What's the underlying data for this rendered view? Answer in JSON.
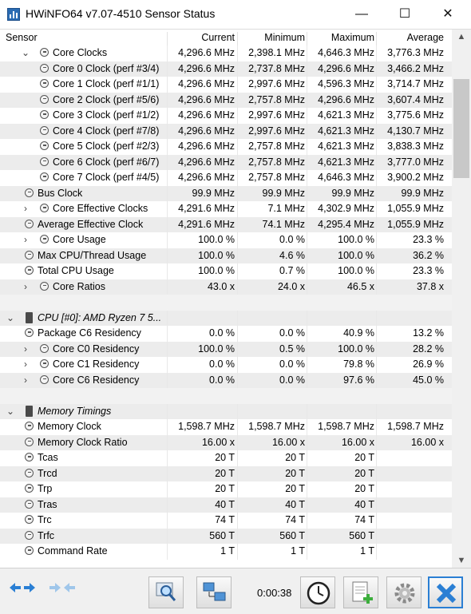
{
  "window": {
    "title": "HWiNFO64 v7.07-4510 Sensor Status",
    "minimize": "—",
    "maximize": "☐",
    "close": "✕"
  },
  "headers": {
    "sensor": "Sensor",
    "current": "Current",
    "minimum": "Minimum",
    "maximum": "Maximum",
    "average": "Average"
  },
  "rows": [
    {
      "indent": 1,
      "chev": "v",
      "icon": "clock",
      "name": "Core Clocks",
      "cur": "4,296.6 MHz",
      "min": "2,398.1 MHz",
      "max": "4,646.3 MHz",
      "avg": "3,776.3 MHz"
    },
    {
      "indent": 2,
      "icon": "clock",
      "name": "Core 0 Clock (perf #3/4)",
      "cur": "4,296.6 MHz",
      "min": "2,737.8 MHz",
      "max": "4,296.6 MHz",
      "avg": "3,466.2 MHz"
    },
    {
      "indent": 2,
      "icon": "clock",
      "name": "Core 1 Clock (perf #1/1)",
      "cur": "4,296.6 MHz",
      "min": "2,997.6 MHz",
      "max": "4,596.3 MHz",
      "avg": "3,714.7 MHz"
    },
    {
      "indent": 2,
      "icon": "clock",
      "name": "Core 2 Clock (perf #5/6)",
      "cur": "4,296.6 MHz",
      "min": "2,757.8 MHz",
      "max": "4,296.6 MHz",
      "avg": "3,607.4 MHz"
    },
    {
      "indent": 2,
      "icon": "clock",
      "name": "Core 3 Clock (perf #1/2)",
      "cur": "4,296.6 MHz",
      "min": "2,997.6 MHz",
      "max": "4,621.3 MHz",
      "avg": "3,775.6 MHz"
    },
    {
      "indent": 2,
      "icon": "clock",
      "name": "Core 4 Clock (perf #7/8)",
      "cur": "4,296.6 MHz",
      "min": "2,997.6 MHz",
      "max": "4,621.3 MHz",
      "avg": "4,130.7 MHz"
    },
    {
      "indent": 2,
      "icon": "clock",
      "name": "Core 5 Clock (perf #2/3)",
      "cur": "4,296.6 MHz",
      "min": "2,757.8 MHz",
      "max": "4,621.3 MHz",
      "avg": "3,838.3 MHz"
    },
    {
      "indent": 2,
      "icon": "clock",
      "name": "Core 6 Clock (perf #6/7)",
      "cur": "4,296.6 MHz",
      "min": "2,757.8 MHz",
      "max": "4,621.3 MHz",
      "avg": "3,777.0 MHz"
    },
    {
      "indent": 2,
      "icon": "clock",
      "name": "Core 7 Clock (perf #4/5)",
      "cur": "4,296.6 MHz",
      "min": "2,757.8 MHz",
      "max": "4,646.3 MHz",
      "avg": "3,900.2 MHz"
    },
    {
      "indent": 0,
      "icon": "clock",
      "name": "Bus Clock",
      "cur": "99.9 MHz",
      "min": "99.9 MHz",
      "max": "99.9 MHz",
      "avg": "99.9 MHz"
    },
    {
      "indent": 1,
      "chev": ">",
      "icon": "clock",
      "name": "Core Effective Clocks",
      "cur": "4,291.6 MHz",
      "min": "7.1 MHz",
      "max": "4,302.9 MHz",
      "avg": "1,055.9 MHz"
    },
    {
      "indent": 0,
      "icon": "clock",
      "name": "Average Effective Clock",
      "cur": "4,291.6 MHz",
      "min": "74.1 MHz",
      "max": "4,295.4 MHz",
      "avg": "1,055.9 MHz"
    },
    {
      "indent": 1,
      "chev": ">",
      "icon": "clock",
      "name": "Core Usage",
      "cur": "100.0 %",
      "min": "0.0 %",
      "max": "100.0 %",
      "avg": "23.3 %"
    },
    {
      "indent": 0,
      "icon": "clock",
      "name": "Max CPU/Thread Usage",
      "cur": "100.0 %",
      "min": "4.6 %",
      "max": "100.0 %",
      "avg": "36.2 %"
    },
    {
      "indent": 0,
      "icon": "clock",
      "name": "Total CPU Usage",
      "cur": "100.0 %",
      "min": "0.7 %",
      "max": "100.0 %",
      "avg": "23.3 %"
    },
    {
      "indent": 1,
      "chev": ">",
      "icon": "clock",
      "name": "Core Ratios",
      "cur": "43.0 x",
      "min": "24.0 x",
      "max": "46.5 x",
      "avg": "37.8 x"
    },
    {
      "blank": true
    },
    {
      "group": true,
      "chev": "v",
      "name": "CPU [#0]: AMD Ryzen 7 5..."
    },
    {
      "indent": 0,
      "icon": "clock",
      "name": "Package C6 Residency",
      "cur": "0.0 %",
      "min": "0.0 %",
      "max": "40.9 %",
      "avg": "13.2 %"
    },
    {
      "indent": 1,
      "chev": ">",
      "icon": "clock",
      "name": "Core C0 Residency",
      "cur": "100.0 %",
      "min": "0.5 %",
      "max": "100.0 %",
      "avg": "28.2 %"
    },
    {
      "indent": 1,
      "chev": ">",
      "icon": "clock",
      "name": "Core C1 Residency",
      "cur": "0.0 %",
      "min": "0.0 %",
      "max": "79.8 %",
      "avg": "26.9 %"
    },
    {
      "indent": 1,
      "chev": ">",
      "icon": "clock",
      "name": "Core C6 Residency",
      "cur": "0.0 %",
      "min": "0.0 %",
      "max": "97.6 %",
      "avg": "45.0 %"
    },
    {
      "blank": true
    },
    {
      "group": true,
      "chev": "v",
      "name": "Memory Timings"
    },
    {
      "indent": 0,
      "icon": "clock",
      "name": "Memory Clock",
      "cur": "1,598.7 MHz",
      "min": "1,598.7 MHz",
      "max": "1,598.7 MHz",
      "avg": "1,598.7 MHz"
    },
    {
      "indent": 0,
      "icon": "clock",
      "name": "Memory Clock Ratio",
      "cur": "16.00 x",
      "min": "16.00 x",
      "max": "16.00 x",
      "avg": "16.00 x"
    },
    {
      "indent": 0,
      "icon": "clock",
      "name": "Tcas",
      "cur": "20 T",
      "min": "20 T",
      "max": "20 T",
      "avg": ""
    },
    {
      "indent": 0,
      "icon": "clock",
      "name": "Trcd",
      "cur": "20 T",
      "min": "20 T",
      "max": "20 T",
      "avg": ""
    },
    {
      "indent": 0,
      "icon": "clock",
      "name": "Trp",
      "cur": "20 T",
      "min": "20 T",
      "max": "20 T",
      "avg": ""
    },
    {
      "indent": 0,
      "icon": "clock",
      "name": "Tras",
      "cur": "40 T",
      "min": "40 T",
      "max": "40 T",
      "avg": ""
    },
    {
      "indent": 0,
      "icon": "clock",
      "name": "Trc",
      "cur": "74 T",
      "min": "74 T",
      "max": "74 T",
      "avg": ""
    },
    {
      "indent": 0,
      "icon": "clock",
      "name": "Trfc",
      "cur": "560 T",
      "min": "560 T",
      "max": "560 T",
      "avg": ""
    },
    {
      "indent": 0,
      "icon": "clock",
      "name": "Command Rate",
      "cur": "1 T",
      "min": "1 T",
      "max": "1 T",
      "avg": ""
    }
  ],
  "toolbar": {
    "timer": "0:00:38",
    "icons": [
      "arrows-left-right-icon",
      "arrows-left-right-disabled-icon",
      "search-sensor-icon",
      "network-computers-icon",
      "clock-icon",
      "report-add-icon",
      "settings-gear-icon",
      "close-x-icon"
    ]
  },
  "colors": {
    "accent": "#2a7fd4",
    "row_alt": "#ececec",
    "group_chip": "#4a4a4a"
  }
}
